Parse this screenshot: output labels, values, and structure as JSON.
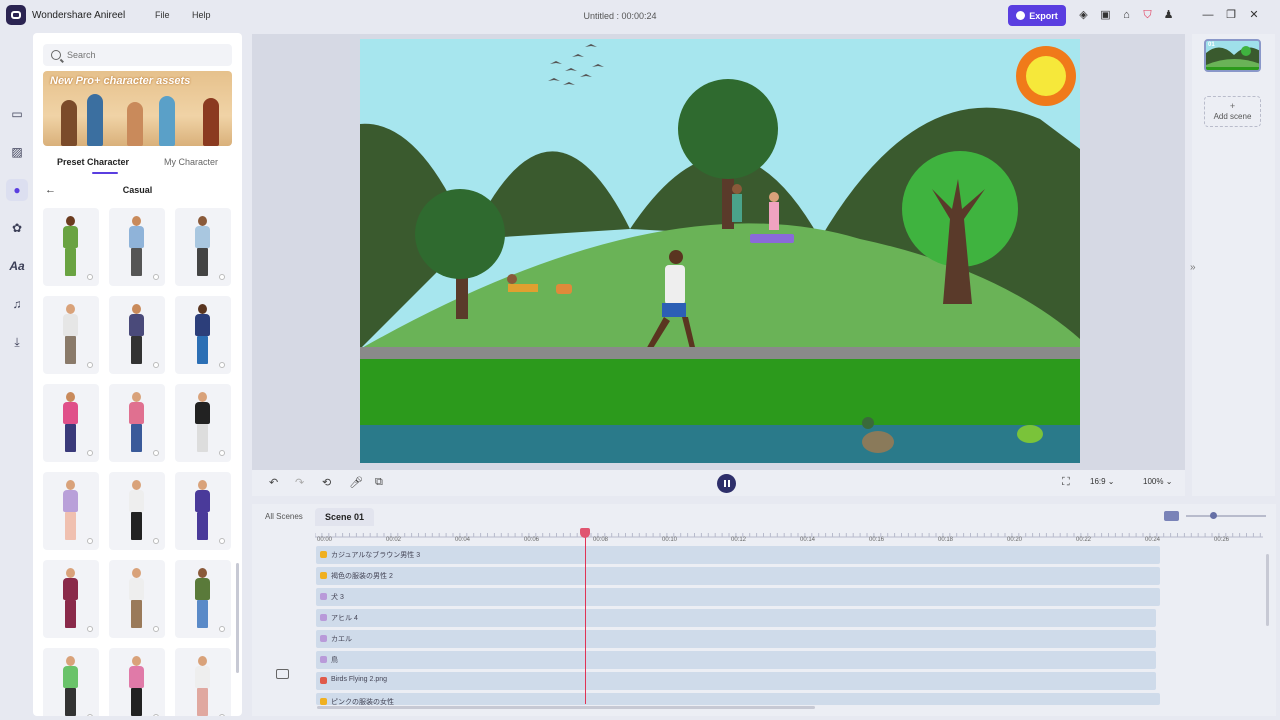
{
  "app": {
    "name": "Wondershare Anireel",
    "doc_title": "Untitled : 00:00:24"
  },
  "menu": {
    "file": "File",
    "help": "Help"
  },
  "toolbar": {
    "export_label": "Export",
    "icons": [
      "cube-icon",
      "save-icon",
      "home-icon",
      "cart-icon",
      "user-icon"
    ]
  },
  "window": {
    "minimize": "—",
    "restore": "❐",
    "close": "✕"
  },
  "rail": {
    "icons": [
      "template-icon",
      "scene-icon",
      "character-icon",
      "props-icon",
      "text-icon",
      "music-icon",
      "import-icon"
    ],
    "active": "character-icon"
  },
  "library": {
    "search_placeholder": "Search",
    "banner_text": "New Pro+ character assets",
    "tabs": [
      "Preset Character",
      "My Character"
    ],
    "active_tab": "Preset Character",
    "category": "Casual",
    "characters": 18
  },
  "preview": {
    "aspect": "16:9",
    "zoom": "100%"
  },
  "scenes": {
    "thumb_label": "01",
    "add_label": "Add scene",
    "add_symbol": "+"
  },
  "timeline": {
    "tabs": [
      "All Scenes",
      "Scene 01"
    ],
    "ticks": [
      "00:00",
      "00:02",
      "00:04",
      "00:06",
      "00:08",
      "00:10",
      "00:12",
      "00:14",
      "00:16",
      "00:18",
      "00:20",
      "00:22",
      "00:24",
      "00:26"
    ],
    "tracks": [
      {
        "label": "カジュアルなブラウン男性 3",
        "type": "character"
      },
      {
        "label": "褐色の服装の男性 2",
        "type": "character"
      },
      {
        "label": "犬 3",
        "type": "prop"
      },
      {
        "label": "アヒル 4",
        "type": "prop"
      },
      {
        "label": "カエル",
        "type": "prop"
      },
      {
        "label": "鳥",
        "type": "prop"
      },
      {
        "label": "Birds Flying 2.png",
        "type": "image"
      },
      {
        "label": "ピンクの服装の女性",
        "type": "character"
      }
    ],
    "playhead_time": "00:08"
  },
  "colors": {
    "accent": "#5a3ee0",
    "playhead": "#e03355",
    "track": "#cfdbea"
  }
}
